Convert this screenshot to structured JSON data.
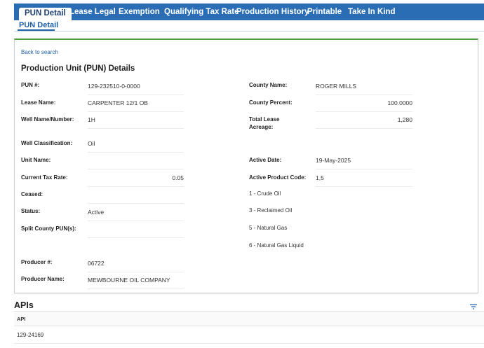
{
  "tabs": [
    {
      "label": "PUN Detail"
    },
    {
      "label": "Lease Legal"
    },
    {
      "label": "Exemption"
    },
    {
      "label": "Qualifying Tax Rate"
    },
    {
      "label": "Production History"
    },
    {
      "label": "Printable"
    },
    {
      "label": "Take In Kind"
    }
  ],
  "subtab": {
    "label": "PUN Detail"
  },
  "back_link": "Back to search",
  "title": "Production Unit (PUN) Details",
  "left_fields": {
    "pun": {
      "label": "PUN #:",
      "value": "129-232510-0-0000"
    },
    "lease_name": {
      "label": "Lease Name:",
      "value": "CARPENTER 12/1 OB"
    },
    "well_name": {
      "label": "Well Name/Number:",
      "value": "1H"
    },
    "well_class": {
      "label": "Well Classification:",
      "value": "Oil"
    },
    "unit_name": {
      "label": "Unit Name:",
      "value": ""
    },
    "tax_rate": {
      "label": "Current Tax Rate:",
      "value": "0.05"
    },
    "ceased": {
      "label": "Ceased:",
      "value": ""
    },
    "status": {
      "label": "Status:",
      "value": "Active"
    },
    "split_county": {
      "label": "Split County PUN(s):",
      "value": ""
    },
    "producer_num": {
      "label": "Producer #:",
      "value": "06722"
    },
    "producer_name": {
      "label": "Producer Name:",
      "value": "MEWBOURNE OIL COMPANY"
    }
  },
  "right_fields": {
    "county_name": {
      "label": "County Name:",
      "value": "ROGER MILLS"
    },
    "county_percent": {
      "label": "County Percent:",
      "value": "100.0000"
    },
    "total_acreage": {
      "label_line1": "Total Lease",
      "label_line2": "Acreage:",
      "value": "1,280"
    },
    "active_date": {
      "label": "Active Date:",
      "value": "19-May-2025"
    },
    "active_product": {
      "label": "Active Product Code:",
      "value": "1,5"
    }
  },
  "product_codes": [
    "1 - Crude Oil",
    "3 - Reclaimed Oil",
    "5 - Natural Gas",
    "6 - Natural Gas Liquid"
  ],
  "apis": {
    "title": "APIs",
    "column_header": "API",
    "rows": [
      "129-24169"
    ]
  },
  "colors": {
    "tab_bar": "#2a6db5",
    "card_top_border": "#4f9a3a",
    "link": "#1f5fa8"
  }
}
